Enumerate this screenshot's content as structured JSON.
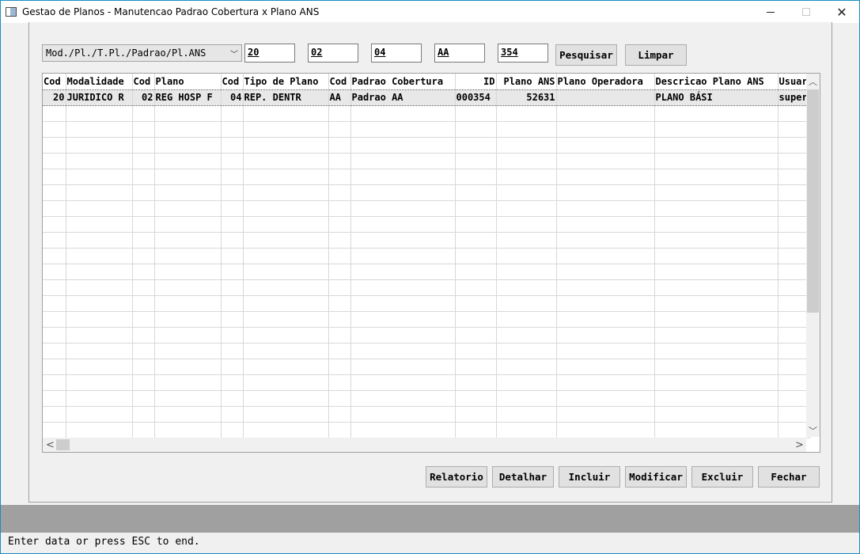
{
  "window": {
    "title": "Gestao de Planos - Manutencao Padrao Cobertura x Plano ANS",
    "close_glyph": "✕"
  },
  "filters": {
    "mode_select": "Mod./Pl./T.Pl./Padrao/Pl.ANS",
    "field1": "20",
    "field2": "02",
    "field3": "04",
    "field4": "AA",
    "field5": "354"
  },
  "toolbar": {
    "search_label": "Pesquisar",
    "clear_label": "Limpar"
  },
  "table": {
    "columns": [
      "Cod",
      "Modalidade",
      "Cod",
      "Plano",
      "Cod",
      "Tipo de Plano",
      "Cod",
      "Padrao Cobertura",
      "ID",
      "Plano ANS",
      "Plano Operadora",
      "Descricao Plano ANS",
      "Usuar"
    ],
    "rows": [
      [
        "20",
        "JURIDICO R",
        "02",
        "REG HOSP F",
        "04",
        "REP. DENTR",
        "AA",
        "Padrao AA",
        "000354",
        "52631",
        "",
        "PLANO BÁSI",
        "super"
      ]
    ]
  },
  "actions": {
    "report": "Relatorio",
    "detail": "Detalhar",
    "include": "Incluir",
    "modify": "Modificar",
    "delete": "Excluir",
    "close": "Fechar"
  },
  "status": {
    "hint": "Enter data or press ESC to end."
  }
}
